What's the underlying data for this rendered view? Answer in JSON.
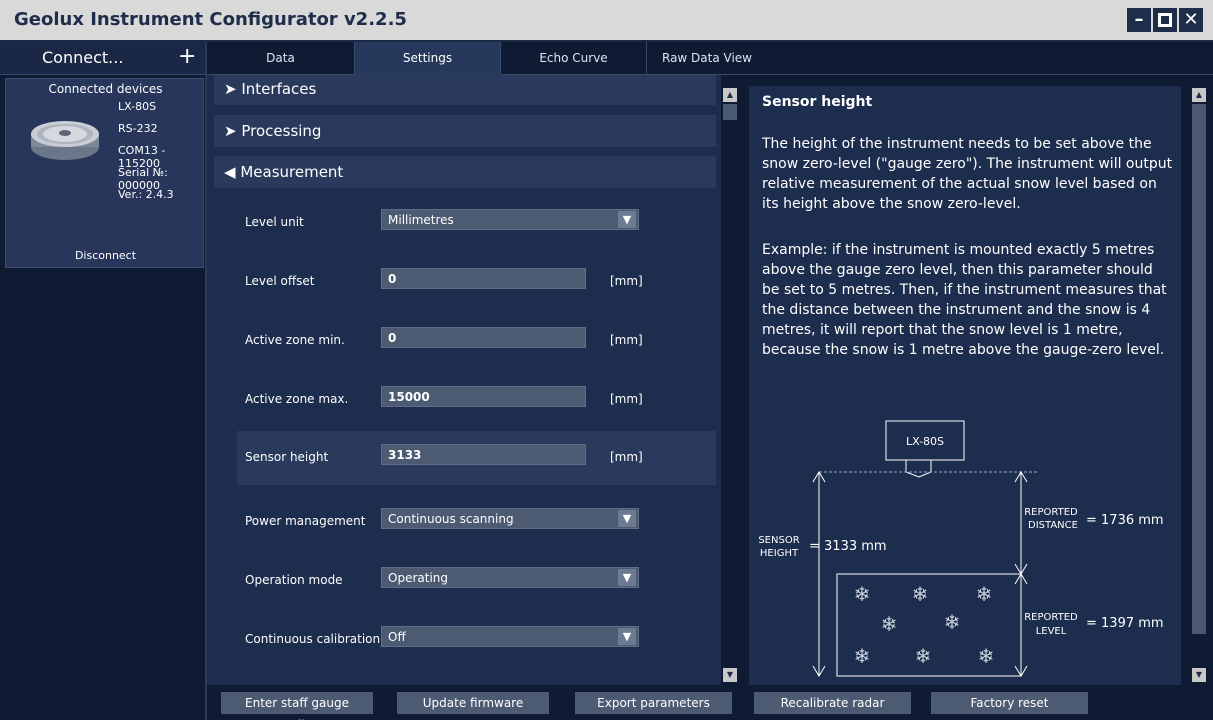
{
  "app": {
    "title": "Geolux Instrument Configurator v2.2.5"
  },
  "window": {
    "minimize": "–",
    "close": "✕"
  },
  "sidebar": {
    "connect_label": "Connect...",
    "connect_plus": "+",
    "devices_title": "Connected devices",
    "device": {
      "model": "LX-80S",
      "interface": "RS-232",
      "port": "COM13 - 115200",
      "serial": "Serial №: 000000",
      "version": "Ver.: 2.4.3",
      "disconnect": "Disconnect"
    }
  },
  "tabs": [
    {
      "label": "Data"
    },
    {
      "label": "Settings"
    },
    {
      "label": "Echo Curve"
    },
    {
      "label": "Raw Data View"
    }
  ],
  "settings": {
    "sections": [
      {
        "label": "Interfaces",
        "arrow": "➤"
      },
      {
        "label": "Processing",
        "arrow": "➤"
      },
      {
        "label": "Measurement",
        "arrow": "◀"
      }
    ],
    "fields": {
      "level_unit": {
        "label": "Level unit",
        "value": "Millimetres"
      },
      "level_offset": {
        "label": "Level offset",
        "value": "0",
        "unit": "[mm]"
      },
      "active_min": {
        "label": "Active zone min.",
        "value": "0",
        "unit": "[mm]"
      },
      "active_max": {
        "label": "Active zone max.",
        "value": "15000",
        "unit": "[mm]"
      },
      "sensor_height": {
        "label": "Sensor height",
        "value": "3133",
        "unit": "[mm]"
      },
      "power": {
        "label": "Power management",
        "value": "Continuous scanning"
      },
      "operation": {
        "label": "Operation mode",
        "value": "Operating"
      },
      "calibration": {
        "label": "Continuous calibration",
        "value": "Off"
      }
    }
  },
  "help": {
    "title": "Sensor height",
    "p1": "The height of the instrument needs to be set above the snow zero-level (\"gauge zero\"). The instrument will output relative measurement of the actual snow level based on its height above the snow zero-level.",
    "p2": "Example: if the instrument is mounted exactly 5 metres above the gauge zero level, then this parameter should be set to 5 metres. Then, if the instrument measures that the distance between the instrument and the snow is 4 metres, it will report that the snow level is 1 metre, because the snow is 1 metre above the gauge-zero level.",
    "diagram": {
      "device_label": "LX-80S",
      "sensor_label_1": "SENSOR",
      "sensor_label_2": "HEIGHT",
      "sensor_value": "= 3133 mm",
      "distance_label_1": "REPORTED",
      "distance_label_2": "DISTANCE",
      "distance_value": "= 1736 mm",
      "level_label_1": "REPORTED",
      "level_label_2": "LEVEL",
      "level_value": "= 1397 mm",
      "snowflake": "❄"
    }
  },
  "buttons": {
    "staff_gauge": "Enter staff gauge reading",
    "firmware": "Update firmware",
    "export": "Export parameters",
    "recalibrate": "Recalibrate radar",
    "factory_reset": "Factory reset"
  }
}
